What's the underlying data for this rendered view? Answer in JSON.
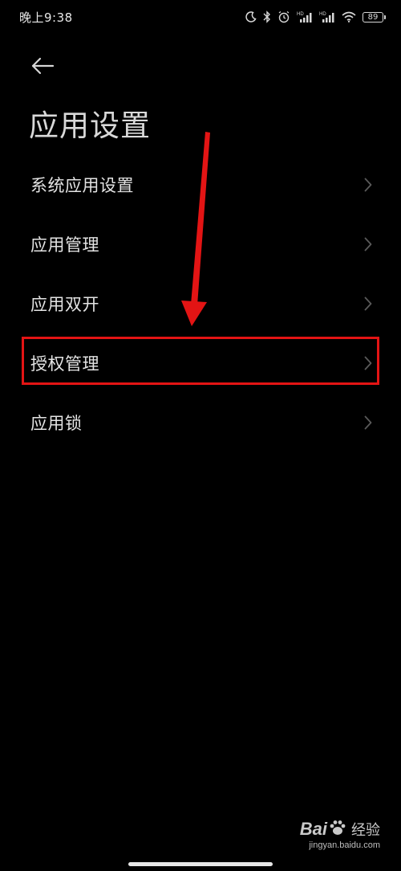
{
  "status_bar": {
    "time": "晚上9:38",
    "battery": "89",
    "icons": [
      "moon-icon",
      "bluetooth-icon",
      "alarm-icon",
      "signal-hd-icon",
      "signal-hd-icon",
      "wifi-icon",
      "battery-icon"
    ]
  },
  "header": {
    "back_icon": "back-arrow-icon",
    "title": "应用设置"
  },
  "list": {
    "items": [
      {
        "label": "系统应用设置"
      },
      {
        "label": "应用管理"
      },
      {
        "label": "应用双开"
      },
      {
        "label": "授权管理"
      },
      {
        "label": "应用锁"
      }
    ]
  },
  "annotation": {
    "highlight_color": "#e31414",
    "highlighted_item": "授权管理"
  },
  "watermark": {
    "brand_bai": "Bai",
    "brand_du": "du",
    "product": "经验",
    "url": "jingyan.baidu.com"
  },
  "colors": {
    "background": "#000000",
    "text": "#e4e4e4",
    "chevron": "#5a5a5a",
    "annotation_red": "#e31414"
  }
}
